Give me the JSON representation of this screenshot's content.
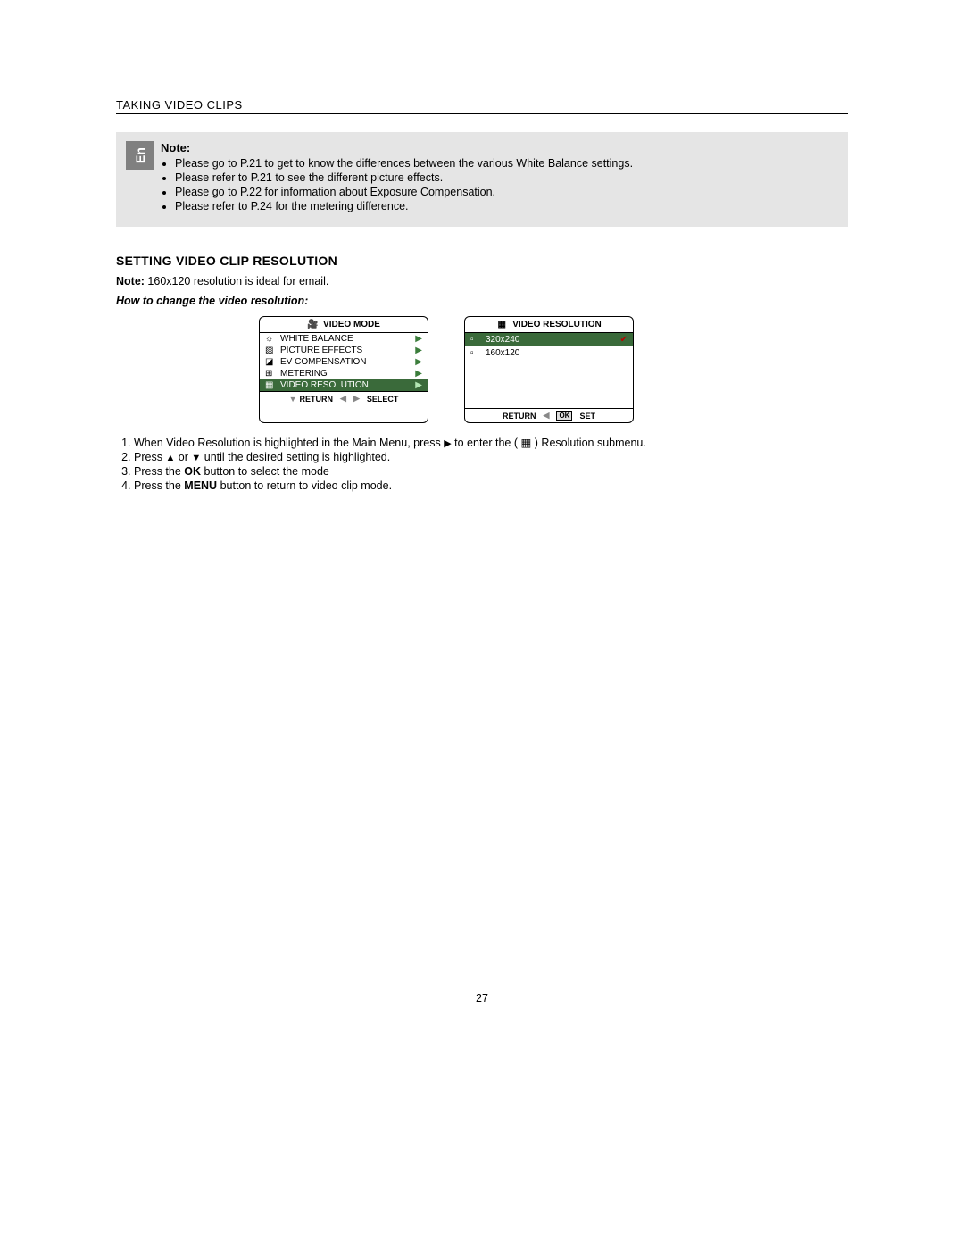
{
  "lang_tab": "En",
  "section_title": "TAKING VIDEO CLIPS",
  "note": {
    "label": "Note:",
    "items": [
      "Please go to P.21 to get to know the differences between the various White Balance settings.",
      "Please refer to P.21 to see the different picture effects.",
      "Please go to P.22 for information about Exposure Compensation.",
      "Please refer to P.24 for the metering difference."
    ]
  },
  "heading": "SETTING VIDEO CLIP RESOLUTION",
  "note2_prefix": "Note:",
  "note2_body": " 160x120 resolution is ideal for email.",
  "howto": "How to change the video resolution:",
  "panel1": {
    "title": "VIDEO MODE",
    "rows": [
      "WHITE BALANCE",
      "PICTURE EFFECTS",
      "EV COMPENSATION",
      "METERING",
      "VIDEO RESOLUTION"
    ],
    "return": "RETURN",
    "select": "SELECT"
  },
  "panel2": {
    "title": "VIDEO RESOLUTION",
    "rows": [
      "320x240",
      "160x120"
    ],
    "return": "RETURN",
    "set": "SET"
  },
  "steps": [
    {
      "pre": "When Video Resolution is highlighted in the Main Menu, press ",
      "mid": " to enter the ( ",
      "mid2": " ) Resolution submenu."
    },
    {
      "pre": "Press ",
      "mid": " or ",
      "post": " until the desired setting is highlighted."
    },
    {
      "pre": "Press the ",
      "btn": "OK",
      "post": " button to select the mode"
    },
    {
      "pre": "Press the ",
      "btn": "MENU",
      "post": " button to return to video clip mode."
    }
  ],
  "page_number": "27",
  "icons": {
    "video_mode": "🎥",
    "res": "▦",
    "wb": "☼",
    "fx": "▨",
    "ev": "◪",
    "meter": "⊞",
    "small_res": "▫"
  }
}
